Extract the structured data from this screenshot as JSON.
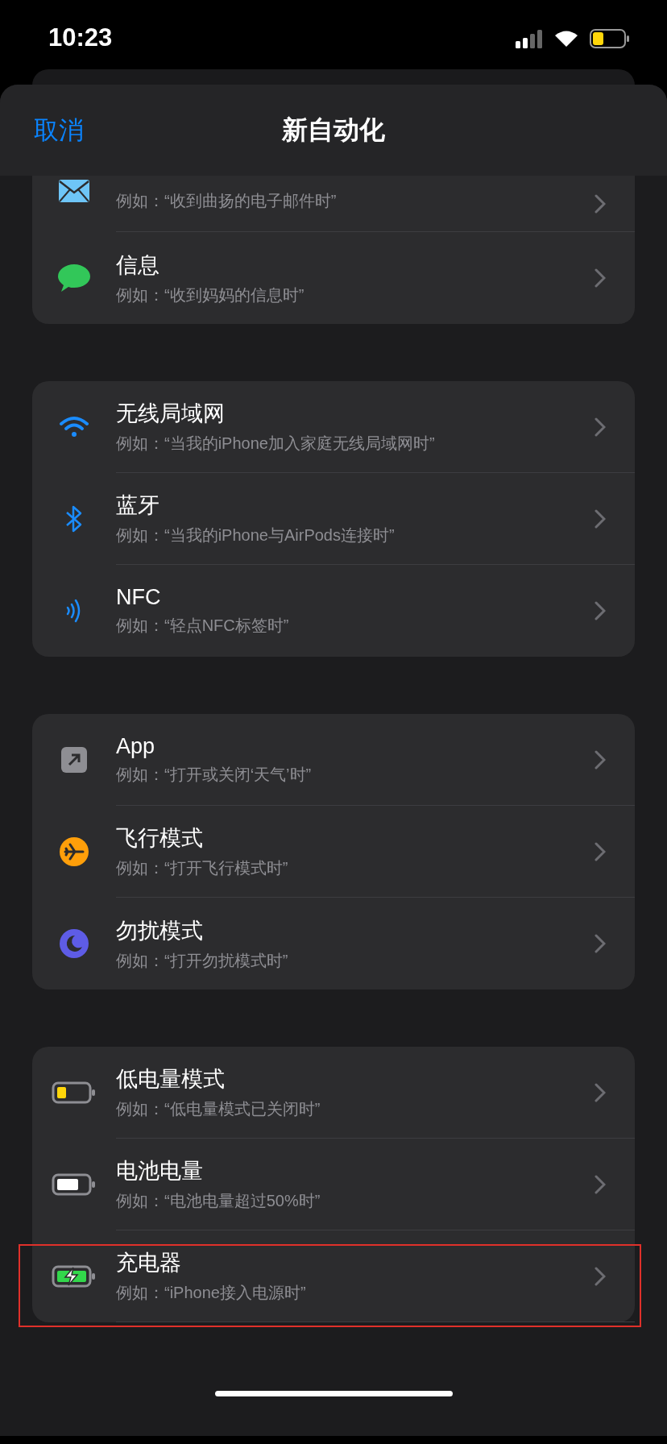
{
  "status_bar": {
    "time": "10:23"
  },
  "nav": {
    "cancel": "取消",
    "title": "新自动化"
  },
  "sections": [
    {
      "items": [
        {
          "subtitle": "例如：“收到曲扬的电子邮件时”",
          "highlighted": false
        },
        {
          "title": "信息",
          "subtitle": "例如：“收到妈妈的信息时”",
          "highlighted": false
        }
      ]
    },
    {
      "items": [
        {
          "title": "无线局域网",
          "subtitle": "例如：“当我的iPhone加入家庭无线局域网时”",
          "highlighted": false
        },
        {
          "title": "蓝牙",
          "subtitle": "例如：“当我的iPhone与AirPods连接时”",
          "highlighted": false
        },
        {
          "title": "NFC",
          "subtitle": "例如：“轻点NFC标签时”",
          "highlighted": false
        }
      ]
    },
    {
      "items": [
        {
          "title": "App",
          "subtitle": "例如：“打开或关闭‘天气’时”",
          "highlighted": false
        },
        {
          "title": "飞行模式",
          "subtitle": "例如：“打开飞行模式时”",
          "highlighted": false
        },
        {
          "title": "勿扰模式",
          "subtitle": "例如：“打开勿扰模式时”",
          "highlighted": false
        }
      ]
    },
    {
      "items": [
        {
          "title": "低电量模式",
          "subtitle": "例如：“低电量模式已关闭时”",
          "highlighted": false
        },
        {
          "title": "电池电量",
          "subtitle": "例如：“电池电量超过50%时”",
          "highlighted": false
        },
        {
          "title": "充电器",
          "subtitle": "例如：“iPhone接入电源时”",
          "highlighted": true
        }
      ]
    }
  ]
}
